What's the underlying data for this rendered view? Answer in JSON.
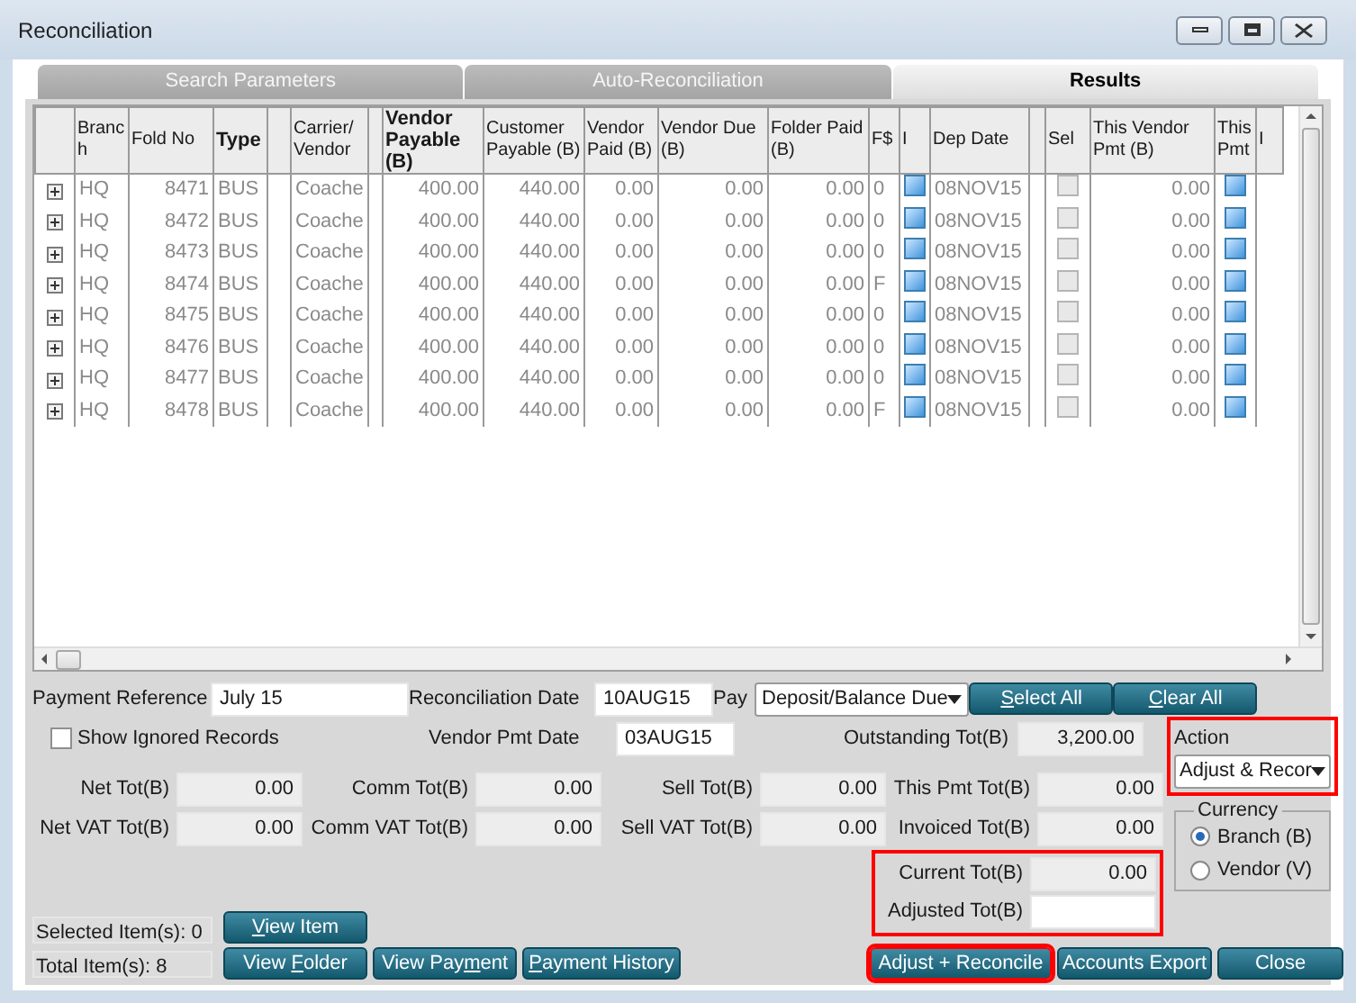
{
  "window": {
    "title": "Reconciliation"
  },
  "tabs": [
    {
      "label": "Search Parameters",
      "selected": false
    },
    {
      "label": "Auto-Reconciliation",
      "selected": false
    },
    {
      "label": "Results",
      "selected": true
    }
  ],
  "table": {
    "columns": [
      {},
      {
        "label": "Branch",
        "bold": false
      },
      {
        "label": "Fold No",
        "bold": false
      },
      {
        "label": "Type",
        "bold": true
      },
      {},
      {
        "label": "Carrier/ Vendor",
        "bold": false
      },
      {},
      {
        "label": "Vendor Payable (B)",
        "bold": true
      },
      {
        "label": "Customer Payable (B)",
        "bold": false
      },
      {
        "label": "Vendor Paid (B)",
        "bold": false
      },
      {
        "label": "Vendor Due (B)",
        "bold": false
      },
      {
        "label": "Folder Paid (B)",
        "bold": false
      },
      {
        "label": "F$",
        "bold": false
      },
      {
        "label": "I",
        "bold": false
      },
      {
        "label": "Dep Date",
        "bold": false
      },
      {},
      {
        "label": "Sel",
        "bold": false
      },
      {
        "label": "This Vendor Pmt (B)",
        "bold": false
      },
      {
        "label": "This Pmt",
        "bold": false
      },
      {
        "label": "I",
        "bold": false
      }
    ],
    "rows": [
      {
        "branch": "HQ",
        "fold_no": "8471",
        "type": "BUS",
        "carrier": "Coache",
        "vendor_payable": "400.00",
        "customer_payable": "440.00",
        "vendor_paid": "0.00",
        "vendor_due": "0.00",
        "folder_paid": "0.00",
        "f_dollar": "0",
        "i_checked": true,
        "dep_date": "08NOV15",
        "sel_checked": false,
        "this_vendor_pmt": "0.00",
        "this_pmt_checked": true
      },
      {
        "branch": "HQ",
        "fold_no": "8472",
        "type": "BUS",
        "carrier": "Coache",
        "vendor_payable": "400.00",
        "customer_payable": "440.00",
        "vendor_paid": "0.00",
        "vendor_due": "0.00",
        "folder_paid": "0.00",
        "f_dollar": "0",
        "i_checked": true,
        "dep_date": "08NOV15",
        "sel_checked": false,
        "this_vendor_pmt": "0.00",
        "this_pmt_checked": true
      },
      {
        "branch": "HQ",
        "fold_no": "8473",
        "type": "BUS",
        "carrier": "Coache",
        "vendor_payable": "400.00",
        "customer_payable": "440.00",
        "vendor_paid": "0.00",
        "vendor_due": "0.00",
        "folder_paid": "0.00",
        "f_dollar": "0",
        "i_checked": true,
        "dep_date": "08NOV15",
        "sel_checked": false,
        "this_vendor_pmt": "0.00",
        "this_pmt_checked": true
      },
      {
        "branch": "HQ",
        "fold_no": "8474",
        "type": "BUS",
        "carrier": "Coache",
        "vendor_payable": "400.00",
        "customer_payable": "440.00",
        "vendor_paid": "0.00",
        "vendor_due": "0.00",
        "folder_paid": "0.00",
        "f_dollar": "F",
        "i_checked": true,
        "dep_date": "08NOV15",
        "sel_checked": false,
        "this_vendor_pmt": "0.00",
        "this_pmt_checked": true
      },
      {
        "branch": "HQ",
        "fold_no": "8475",
        "type": "BUS",
        "carrier": "Coache",
        "vendor_payable": "400.00",
        "customer_payable": "440.00",
        "vendor_paid": "0.00",
        "vendor_due": "0.00",
        "folder_paid": "0.00",
        "f_dollar": "0",
        "i_checked": true,
        "dep_date": "08NOV15",
        "sel_checked": false,
        "this_vendor_pmt": "0.00",
        "this_pmt_checked": true
      },
      {
        "branch": "HQ",
        "fold_no": "8476",
        "type": "BUS",
        "carrier": "Coache",
        "vendor_payable": "400.00",
        "customer_payable": "440.00",
        "vendor_paid": "0.00",
        "vendor_due": "0.00",
        "folder_paid": "0.00",
        "f_dollar": "0",
        "i_checked": true,
        "dep_date": "08NOV15",
        "sel_checked": false,
        "this_vendor_pmt": "0.00",
        "this_pmt_checked": true
      },
      {
        "branch": "HQ",
        "fold_no": "8477",
        "type": "BUS",
        "carrier": "Coache",
        "vendor_payable": "400.00",
        "customer_payable": "440.00",
        "vendor_paid": "0.00",
        "vendor_due": "0.00",
        "folder_paid": "0.00",
        "f_dollar": "0",
        "i_checked": true,
        "dep_date": "08NOV15",
        "sel_checked": false,
        "this_vendor_pmt": "0.00",
        "this_pmt_checked": true
      },
      {
        "branch": "HQ",
        "fold_no": "8478",
        "type": "BUS",
        "carrier": "Coache",
        "vendor_payable": "400.00",
        "customer_payable": "440.00",
        "vendor_paid": "0.00",
        "vendor_due": "0.00",
        "folder_paid": "0.00",
        "f_dollar": "F",
        "i_checked": true,
        "dep_date": "08NOV15",
        "sel_checked": false,
        "this_vendor_pmt": "0.00",
        "this_pmt_checked": true
      }
    ]
  },
  "form": {
    "payment_reference": {
      "label": "Payment Reference",
      "value": "July 15"
    },
    "reconciliation_date": {
      "label": "Reconciliation Date",
      "value": "10AUG15"
    },
    "pay": {
      "label": "Pay",
      "value": "Deposit/Balance Due"
    },
    "select_all": {
      "key": "S",
      "post": "elect All"
    },
    "clear_all": {
      "key": "C",
      "post": "lear All"
    },
    "show_ignored": {
      "label": "Show Ignored Records",
      "checked": false
    },
    "vendor_pmt_date": {
      "label": "Vendor Pmt Date",
      "value": "03AUG15"
    },
    "outstanding": {
      "label": "Outstanding Tot(B)",
      "value": "3,200.00"
    },
    "action": {
      "label": "Action",
      "value": "Adjust & Recor",
      "highlighted": true
    },
    "totals_rows": [
      [
        {
          "label": "Net Tot(B)",
          "value": "0.00"
        },
        {
          "label": "Comm Tot(B)",
          "value": "0.00"
        },
        {
          "label": "Sell Tot(B)",
          "value": "0.00"
        },
        {
          "label": "This Pmt Tot(B)",
          "value": "0.00"
        }
      ],
      [
        {
          "label": "Net VAT Tot(B)",
          "value": "0.00"
        },
        {
          "label": "Comm VAT Tot(B)",
          "value": "0.00"
        },
        {
          "label": "Sell VAT Tot(B)",
          "value": "0.00"
        },
        {
          "label": "Invoiced Tot(B)",
          "value": "0.00"
        }
      ]
    ],
    "adjust_group": {
      "highlighted": true,
      "current": {
        "label": "Current Tot(B)",
        "value": "0.00"
      },
      "adjusted": {
        "label": "Adjusted Tot(B)"
      }
    },
    "currency": {
      "label": "Currency",
      "options": [
        {
          "label": "Branch (B)",
          "selected": true
        },
        {
          "label": "Vendor (V)",
          "selected": false
        }
      ]
    }
  },
  "status": {
    "selected_items": "Selected Item(s): 0",
    "total_items": "Total Item(s): 8"
  },
  "buttons": {
    "view_item": {
      "key": "V",
      "post": "iew Item",
      "highlighted": false
    },
    "row": [
      {
        "pre": "View ",
        "key": "F",
        "post": "older",
        "highlighted": false
      },
      {
        "pre": "View Pay",
        "key": "m",
        "post": "ent",
        "highlighted": false
      },
      {
        "key": "P",
        "post": "ayment History",
        "highlighted": false
      }
    ],
    "right": [
      {
        "pre": "Adjust + Reconcile",
        "highlighted": true
      },
      {
        "pre": "Accounts Export",
        "highlighted": false
      },
      {
        "pre": "Close",
        "highlighted": false
      }
    ]
  }
}
